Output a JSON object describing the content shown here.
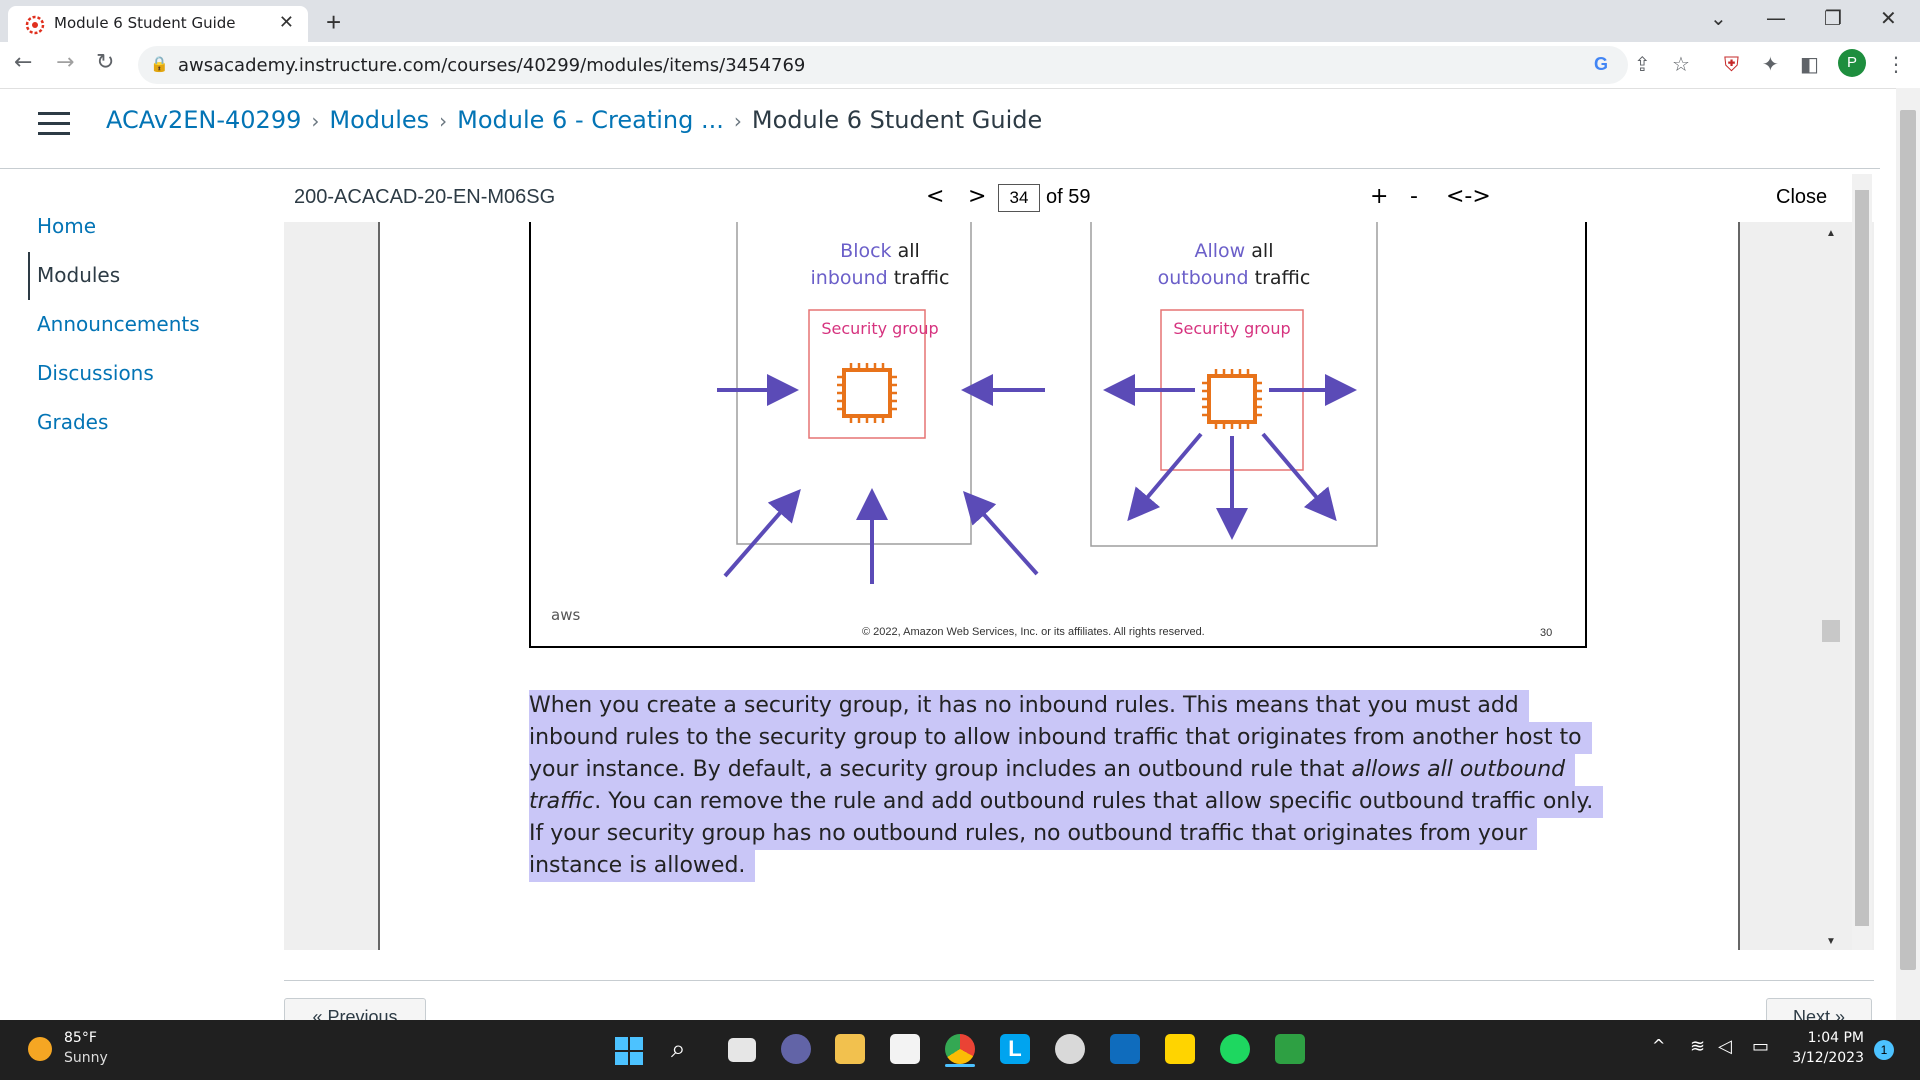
{
  "browser": {
    "tab_title": "Module 6 Student Guide",
    "url": "awsacademy.instructure.com/courses/40299/modules/items/3454769",
    "profile_initial": "P"
  },
  "breadcrumb": {
    "course": "ACAv2EN-40299",
    "modules": "Modules",
    "module": "Module 6 - Creating ...",
    "current": "Module 6 Student Guide"
  },
  "nav": {
    "items": [
      "Home",
      "Modules",
      "Announcements",
      "Discussions",
      "Grades"
    ],
    "active": "Modules"
  },
  "viewer": {
    "doc_name": "200-ACACAD-20-EN-M06SG",
    "prev": "<",
    "next": ">",
    "page": "34",
    "of_pages": "of 59",
    "zoom_in": "+",
    "zoom_out": "-",
    "fit": "<->",
    "close": "Close"
  },
  "slide": {
    "left_panel": {
      "word1": "Block",
      "word2": "all",
      "word3": "inbound",
      "word4": "traffic",
      "box_label": "Security group"
    },
    "right_panel": {
      "word1": "Allow",
      "word2": "all",
      "word3": "outbound",
      "word4": "traffic",
      "box_label": "Security group"
    },
    "logo": "aws",
    "copyright": "© 2022, Amazon Web Services, Inc. or its affiliates. All rights reserved.",
    "page_number": "30",
    "arrow_color": "#5b4bb7",
    "chip_color": "#e8731a"
  },
  "notes": {
    "line1": "When you create a security group, it has no inbound rules. This means that you must add",
    "line2": "inbound rules to the security group to allow inbound traffic that originates from another host to",
    "line3a": "your instance. By default, a security group includes an outbound rule that ",
    "line3b": "allows all outbound",
    "line4a": "traffic",
    "line4b": ". You can remove the rule and add outbound rules that allow specific outbound traffic only.",
    "line5": "If your security group has no outbound rules, no outbound traffic that originates from your",
    "line6": "instance is allowed."
  },
  "pager": {
    "previous": "« Previous",
    "next": "Next »"
  },
  "taskbar": {
    "weather_temp": "85°F",
    "weather_desc": "Sunny",
    "time": "1:04 PM",
    "date": "3/12/2023",
    "notification_count": "1"
  }
}
